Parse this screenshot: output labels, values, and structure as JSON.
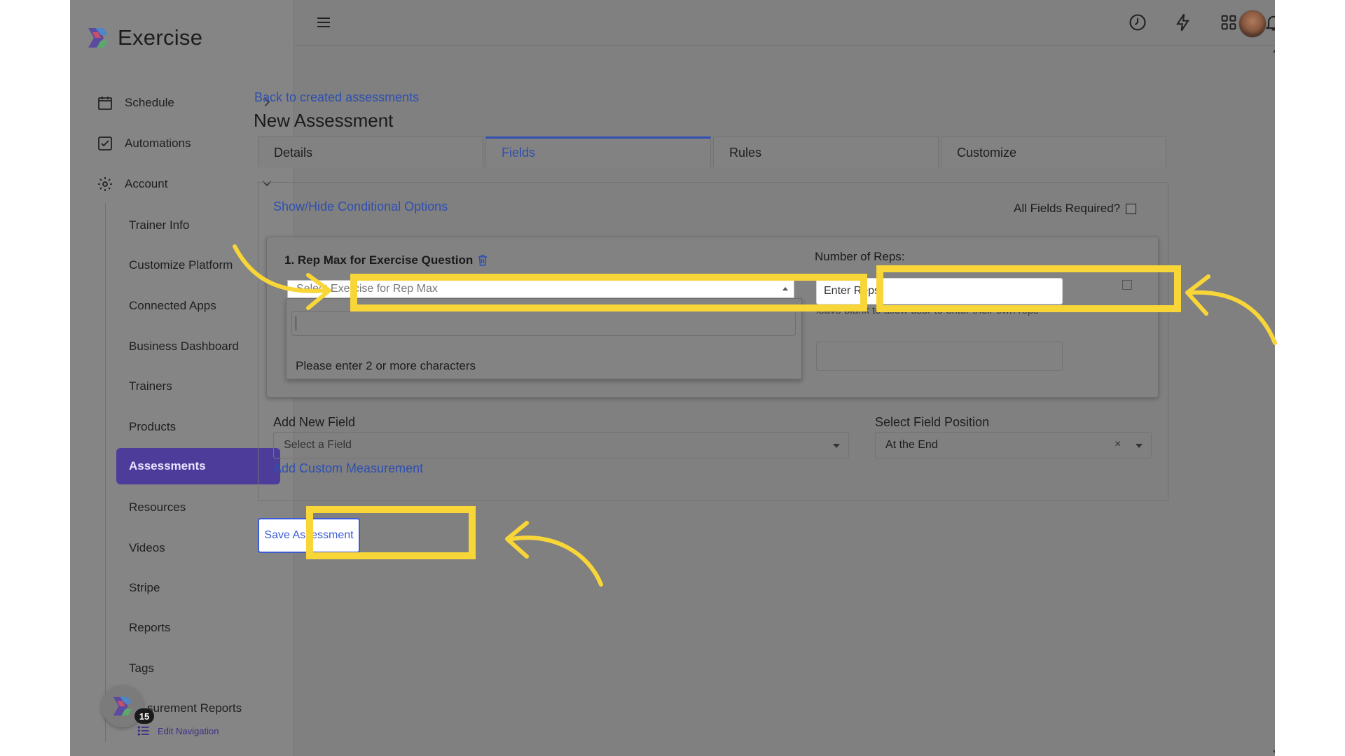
{
  "app": {
    "name": "Exercise"
  },
  "sidebar": {
    "main_items": [
      {
        "label": "Schedule",
        "icon": "calendar-icon"
      },
      {
        "label": "Automations",
        "icon": "checkbox-icon"
      },
      {
        "label": "Account",
        "icon": "gear-icon"
      }
    ],
    "sub_items": [
      "Trainer Info",
      "Customize Platform",
      "Connected Apps",
      "Business Dashboard",
      "Trainers",
      "Products",
      "Assessments",
      "Resources",
      "Videos",
      "Stripe",
      "Reports",
      "Tags",
      "surement Reports"
    ],
    "active_item": "Assessments",
    "badge_count": "15",
    "edit_nav_label": "Edit Navigation"
  },
  "header": {
    "icons": [
      "menu-icon",
      "clock-icon",
      "lightning-icon",
      "apps-grid-icon",
      "bell-icon",
      "avatar"
    ],
    "notification_dot_color": "#4e3cc4"
  },
  "page": {
    "back_link": "Back to created assessments",
    "title": "New Assessment",
    "tabs": [
      "Details",
      "Fields",
      "Rules",
      "Customize"
    ],
    "active_tab": "Fields",
    "conditional_link": "Show/Hide Conditional Options",
    "all_fields_required_label": "All Fields Required?"
  },
  "question": {
    "title": "1. Rep Max for Exercise Question",
    "exercise_select_placeholder": "Select Exercise for Rep Max",
    "dropdown_message": "Please enter 2 or more characters",
    "reps_label": "Number of Reps:",
    "reps_placeholder": "Enter Reps",
    "reps_help": "leave blank to allow user to enter their own reps"
  },
  "add_field": {
    "label": "Add New Field",
    "placeholder": "Select a Field",
    "position_label": "Select Field Position",
    "position_value": "At the End",
    "clear_symbol": "×",
    "custom_link": "Add Custom Measurement"
  },
  "actions": {
    "save_label": "Save Assessment"
  },
  "colors": {
    "overlay_gray": "#808080",
    "highlight": "#f8d638",
    "link": "#2f4fb0",
    "active_nav": "#4e3c9b",
    "button_border": "#3b5bd6"
  }
}
